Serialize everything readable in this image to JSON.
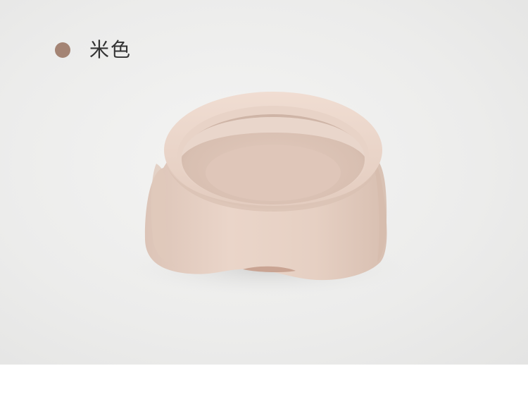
{
  "variant": {
    "color_name": "米色",
    "swatch_color": "#a48474"
  },
  "product": {
    "icon": "pet-bowl-photo",
    "bowl_color": "#e8d2c6"
  }
}
